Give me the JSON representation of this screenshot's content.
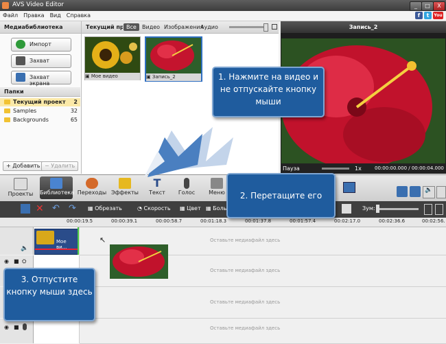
{
  "window": {
    "title": "AVS Video Editor",
    "buttons": [
      "_",
      "□",
      "X"
    ]
  },
  "social": [
    "f",
    "t",
    "You"
  ],
  "menu": [
    "Файл",
    "Правка",
    "Вид",
    "Справка"
  ],
  "media_library": {
    "title": "Медиабиблиотека",
    "buttons": {
      "import": "Импорт",
      "capture": "Захват",
      "screen_capture": "Захват экрана"
    }
  },
  "folders": {
    "title": "Папки",
    "items": [
      {
        "name": "Текущий проект",
        "count": "2"
      },
      {
        "name": "Samples",
        "count": "32"
      },
      {
        "name": "Backgrounds",
        "count": "65"
      }
    ],
    "add_label": "+ Добавить",
    "delete_label": "− Удалить"
  },
  "library": {
    "current": "Текущий проект",
    "tabs": [
      "Все",
      "Видео",
      "Изображения",
      "Аудио"
    ],
    "thumbs": [
      {
        "caption": "Мое видео"
      },
      {
        "caption": "Запись_2"
      }
    ]
  },
  "preview": {
    "title": "Запись_2",
    "status": "Пауза",
    "speed": "1x",
    "time": "00:00:00.000 / 00:00:04.000"
  },
  "toolbar": {
    "buttons": [
      "Проекты",
      "Библиотека",
      "Переходы",
      "Эффекты",
      "Текст",
      "Голос",
      "Меню"
    ]
  },
  "timeline_tools": {
    "trim": "Обрезать",
    "speed": "Скорость",
    "color": "Цвет",
    "more": "Боль",
    "zoom": "Зум:"
  },
  "ruler": [
    "00:00:19.5",
    "00:00:39.1",
    "00:00:58.7",
    "00:01:18.3",
    "00:01:37.8",
    "00:01:57.4",
    "00:02:17.0",
    "00:02:36.6",
    "00:02:56."
  ],
  "tracks": {
    "clip_label": "Мое ви...",
    "drop_hint": "Оставьте медиафайл здесь"
  },
  "callouts": {
    "step1": "1. Нажмите на видео и не отпускайте кнопку мыши",
    "step2": "2. Перетащите его",
    "step3": "3. Отпустите кнопку мыши здесь"
  },
  "colors": {
    "accent": "#1f5c9e",
    "callout_border": "#7fa6d2",
    "clip": "#2a4c8a"
  }
}
